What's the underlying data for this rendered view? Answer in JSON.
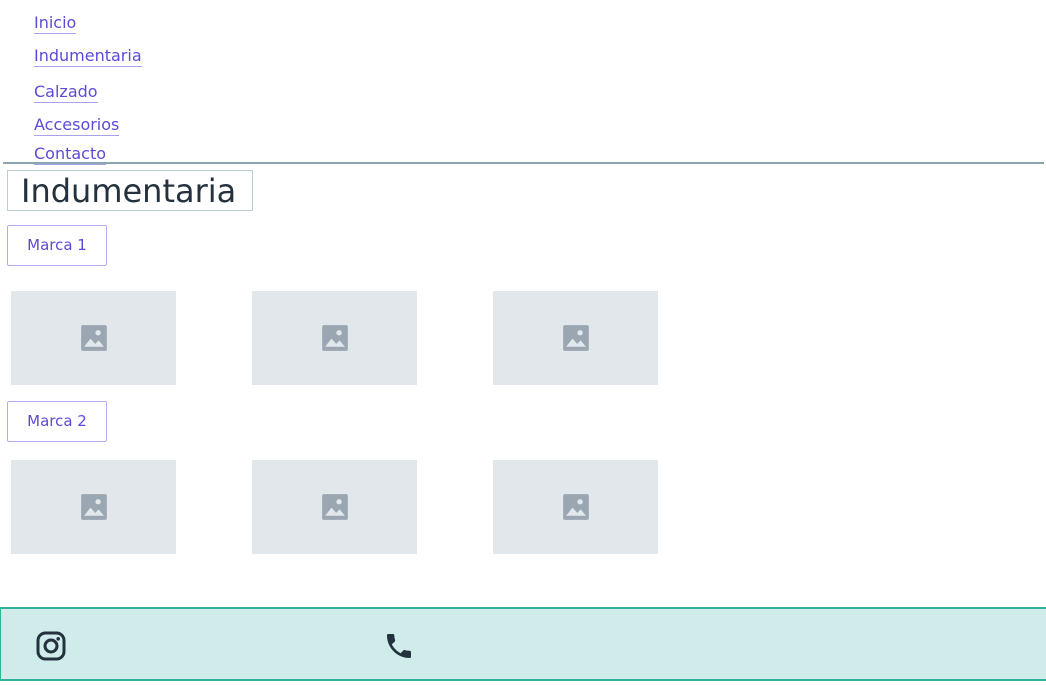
{
  "nav": {
    "items": [
      {
        "label": "Inicio"
      },
      {
        "label": "Indumentaria"
      },
      {
        "label": "Calzado"
      },
      {
        "label": "Accesorios"
      },
      {
        "label": "Contacto"
      }
    ]
  },
  "page": {
    "title": "Indumentaria"
  },
  "sections": [
    {
      "brand_label": "Marca 1",
      "image_count": 3
    },
    {
      "brand_label": "Marca 2",
      "image_count": 3
    }
  ],
  "icons": {
    "image_placeholder": "image-icon",
    "instagram": "instagram-icon",
    "phone": "phone-icon"
  },
  "colors": {
    "link": "#5b4bd6",
    "placeholder_bg": "#e2e7ec",
    "footer_bg": "#cfeceb",
    "footer_border": "#2eb39b"
  }
}
